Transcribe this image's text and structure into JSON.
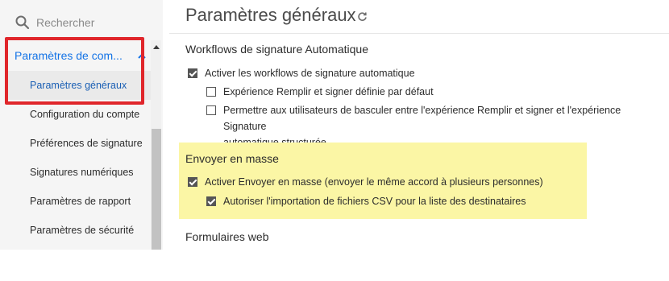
{
  "sidebar": {
    "search_placeholder": "Rechercher",
    "parent_item": "Paramètres de com...",
    "items": [
      {
        "label": "Paramètres généraux"
      },
      {
        "label": "Configuration du compte"
      },
      {
        "label": "Préférences de signature"
      },
      {
        "label": "Signatures numériques"
      },
      {
        "label": "Paramètres de rapport"
      },
      {
        "label": "Paramètres de sécurité"
      }
    ]
  },
  "main": {
    "title": "Paramètres généraux",
    "sections": {
      "workflows": {
        "title": "Workflows de signature Automatique",
        "enable": "Activer les workflows de signature automatique",
        "fill_sign_default": "Expérience Remplir et signer définie par défaut",
        "allow_switch_line1": "Permettre aux utilisateurs de basculer entre l'expérience Remplir et signer et l'expérience Signature",
        "allow_switch_line2": "automatique structurée"
      },
      "bulk": {
        "title": "Envoyer en masse",
        "enable": "Activer Envoyer en masse (envoyer le même accord à plusieurs personnes)",
        "csv_import": "Autoriser l'importation de fichiers CSV pour la liste des destinataires"
      },
      "web_forms": {
        "title": "Formulaires web"
      }
    }
  },
  "colors": {
    "accent_blue": "#1473e6",
    "highlight_red": "#e0262b",
    "highlight_yellow": "#fbf6a5"
  }
}
